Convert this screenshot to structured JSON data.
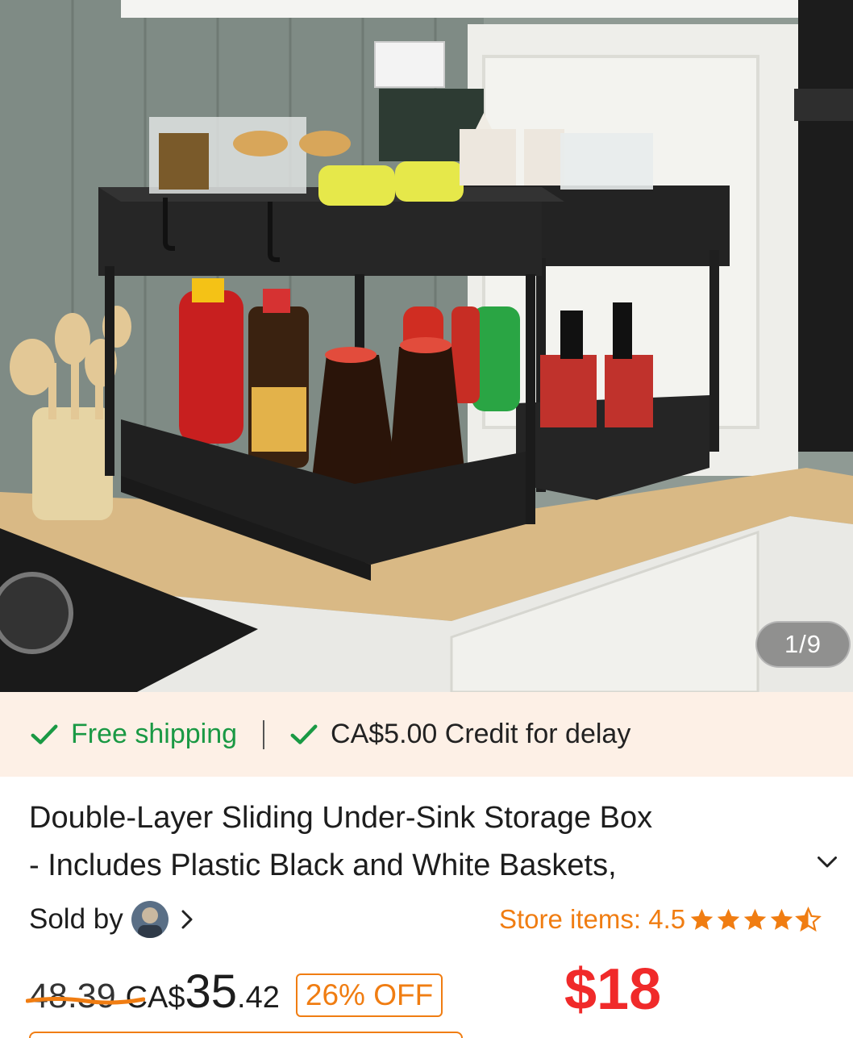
{
  "gallery": {
    "counter": "1/9"
  },
  "shipping": {
    "free_label": "Free shipping",
    "credit_label": "CA$5.00 Credit for delay",
    "check_icon_color": "#1a9944"
  },
  "product": {
    "title_line1": "Double-Layer Sliding Under-Sink Storage Box",
    "title_line2": "- Includes Plastic Black and White Baskets,",
    "expand_icon": "chevron-down-icon"
  },
  "seller": {
    "sold_by_label": "Sold by",
    "store_label": "Store items: 4.5",
    "rating": 4.5,
    "star_color": "#f07d12"
  },
  "price": {
    "original": "48.39",
    "currency": "CA$",
    "whole": "35",
    "cents": ".42",
    "discount": "26% OFF",
    "promo": "$18",
    "accent": "#f07d12",
    "promo_color": "#f02a2a"
  }
}
